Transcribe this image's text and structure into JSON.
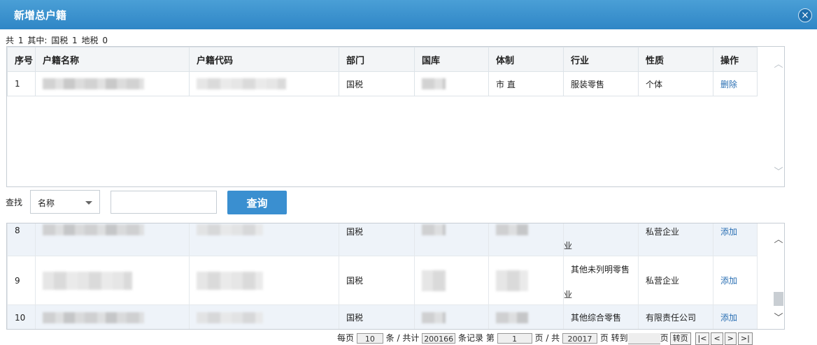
{
  "dialog": {
    "title": "新增总户籍",
    "close_symbol": "×"
  },
  "summary": {
    "total_label": "共",
    "total": "1",
    "among_label": "其中:",
    "guoshui_label": "国税",
    "guoshui": "1",
    "dishui_label": "地税",
    "dishui": "0"
  },
  "columns": {
    "seq": "序号",
    "name": "户籍名称",
    "code": "户籍代码",
    "dept": "部门",
    "treasury": "国库",
    "system": "体制",
    "industry": "行业",
    "nature": "性质",
    "op": "操作"
  },
  "selected_rows": [
    {
      "seq": "1",
      "dept": "国税",
      "system": "市 直",
      "industry": "服装零售",
      "nature": "个体",
      "action": "删除"
    }
  ],
  "search": {
    "label": "查找",
    "field_value": "名称",
    "input_value": "",
    "button": "查询"
  },
  "result_rows": [
    {
      "seq": "8",
      "dept": "国税",
      "industry_top": "",
      "industry_bottom": "业",
      "nature": "私营企业",
      "action": "添加"
    },
    {
      "seq": "9",
      "dept": "国税",
      "industry_top": "其他未列明零售",
      "industry_bottom": "业",
      "nature": "私营企业",
      "action": "添加"
    },
    {
      "seq": "10",
      "dept": "国税",
      "industry_top": "其他综合零售",
      "industry_bottom": "",
      "nature": "有限责任公司",
      "action": "添加"
    }
  ],
  "pager": {
    "per_page_label": "每页",
    "per_page": "10",
    "unit_label": "条 / 共计",
    "total_records": "200166",
    "records_label": "条记录 第",
    "current_page": "1",
    "page_of_label": "页 / 共",
    "total_pages": "20017",
    "page_label": "页 转到",
    "goto_suffix": "页",
    "goto_button": "转页",
    "first": "|<",
    "prev": "<",
    "next": ">",
    "last": ">|"
  },
  "colors": {
    "title_bar": "#3a90cc",
    "button": "#3a8fd0",
    "link": "#2a6fb3"
  }
}
